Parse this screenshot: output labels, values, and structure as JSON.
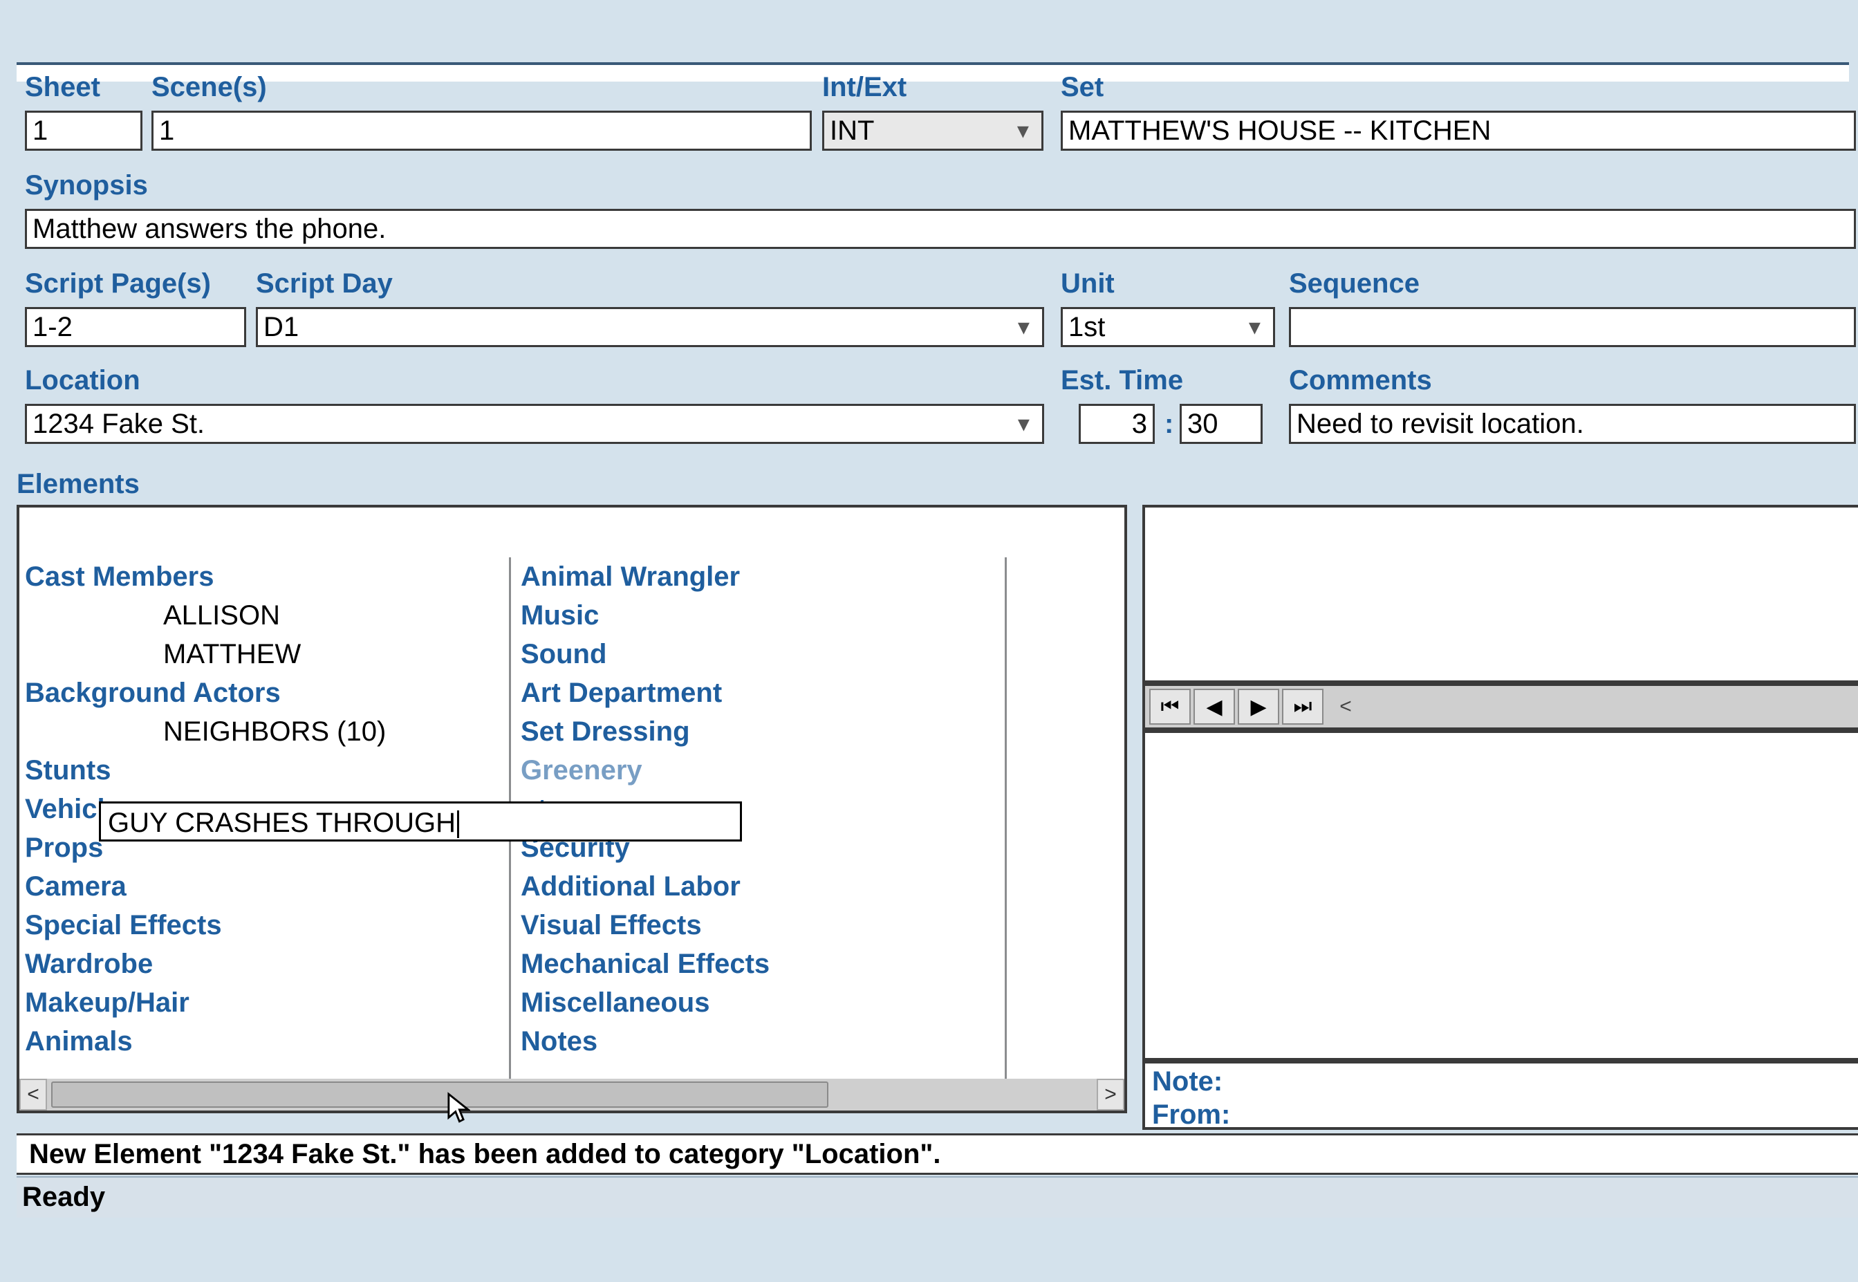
{
  "labels": {
    "sheet": "Sheet",
    "scenes": "Scene(s)",
    "intext": "Int/Ext",
    "set": "Set",
    "synopsis": "Synopsis",
    "script_pages": "Script Page(s)",
    "script_day": "Script Day",
    "unit": "Unit",
    "sequence": "Sequence",
    "location": "Location",
    "est_time": "Est. Time",
    "comments": "Comments",
    "elements": "Elements",
    "note": "Note:",
    "from": "From:"
  },
  "fields": {
    "sheet": "1",
    "scenes": "1",
    "intext": "INT",
    "set": "MATTHEW'S HOUSE -- KITCHEN",
    "synopsis": "Matthew answers the phone.",
    "script_pages": "1-2",
    "script_day": "D1",
    "unit": "1st",
    "sequence": "",
    "location": "1234 Fake St.",
    "est_time_h": "3",
    "est_time_m": "30",
    "comments": "Need to revisit location."
  },
  "elements": {
    "col1": [
      {
        "type": "cat",
        "text": "Cast Members"
      },
      {
        "type": "item",
        "text": "ALLISON"
      },
      {
        "type": "item",
        "text": "MATTHEW"
      },
      {
        "type": "cat",
        "text": "Background Actors"
      },
      {
        "type": "item",
        "text": "NEIGHBORS (10)"
      },
      {
        "type": "cat",
        "text": "Stunts"
      },
      {
        "type": "cat",
        "text": "Vehicles"
      },
      {
        "type": "cat",
        "text": "Props"
      },
      {
        "type": "cat",
        "text": "Camera"
      },
      {
        "type": "cat",
        "text": "Special Effects"
      },
      {
        "type": "cat",
        "text": "Wardrobe"
      },
      {
        "type": "cat",
        "text": "Makeup/Hair"
      },
      {
        "type": "cat",
        "text": "Animals"
      }
    ],
    "col2": [
      {
        "type": "cat",
        "text": "Animal Wrangler"
      },
      {
        "type": "cat",
        "text": "Music"
      },
      {
        "type": "cat",
        "text": "Sound"
      },
      {
        "type": "cat",
        "text": "Art Department"
      },
      {
        "type": "cat",
        "text": "Set Dressing"
      },
      {
        "type": "cat",
        "text": "Greenery",
        "partial": true
      },
      {
        "type": "cat",
        "text": "nt",
        "suffix": true
      },
      {
        "type": "cat",
        "text": "Security"
      },
      {
        "type": "cat",
        "text": "Additional Labor"
      },
      {
        "type": "cat",
        "text": "Visual Effects"
      },
      {
        "type": "cat",
        "text": "Mechanical Effects"
      },
      {
        "type": "cat",
        "text": "Miscellaneous"
      },
      {
        "type": "cat",
        "text": "Notes"
      }
    ],
    "inline_editor": "GUY CRASHES THROUGH"
  },
  "message": "New Element \"1234 Fake St.\" has been added to category \"Location\".",
  "status": "Ready",
  "nav_extra": "<"
}
